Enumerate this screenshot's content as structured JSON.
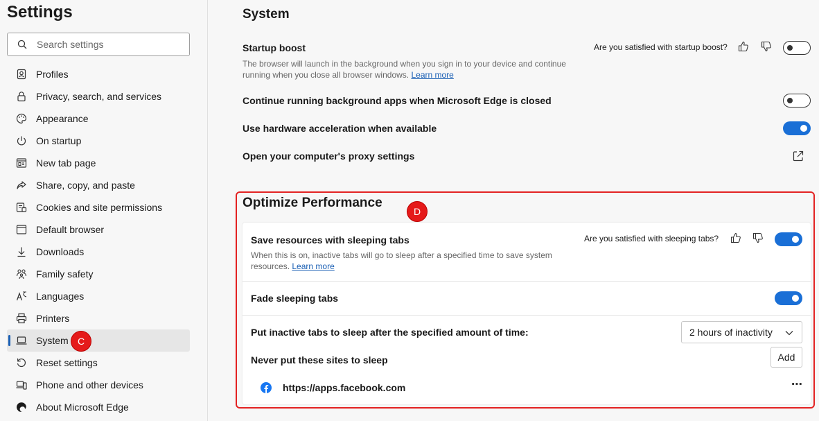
{
  "sidebar": {
    "title": "Settings",
    "search_placeholder": "Search settings",
    "items": [
      {
        "label": "Profiles",
        "icon": "profile-icon"
      },
      {
        "label": "Privacy, search, and services",
        "icon": "lock-icon"
      },
      {
        "label": "Appearance",
        "icon": "palette-icon"
      },
      {
        "label": "On startup",
        "icon": "power-icon"
      },
      {
        "label": "New tab page",
        "icon": "grid-icon"
      },
      {
        "label": "Share, copy, and paste",
        "icon": "share-icon"
      },
      {
        "label": "Cookies and site permissions",
        "icon": "cookies-icon"
      },
      {
        "label": "Default browser",
        "icon": "browser-icon"
      },
      {
        "label": "Downloads",
        "icon": "download-icon"
      },
      {
        "label": "Family safety",
        "icon": "family-icon"
      },
      {
        "label": "Languages",
        "icon": "language-icon"
      },
      {
        "label": "Printers",
        "icon": "printer-icon"
      },
      {
        "label": "System",
        "icon": "laptop-icon",
        "active": true
      },
      {
        "label": "Reset settings",
        "icon": "reset-icon"
      },
      {
        "label": "Phone and other devices",
        "icon": "phone-icon"
      },
      {
        "label": "About Microsoft Edge",
        "icon": "edge-icon"
      }
    ]
  },
  "markers": {
    "c": "C",
    "d": "D"
  },
  "system": {
    "title": "System",
    "startup_boost": {
      "title": "Startup boost",
      "desc": "The browser will launch in the background when you sign in to your device and continue running when you close all browser windows.",
      "learn_more": "Learn more",
      "feedback": "Are you satisfied with startup boost?",
      "enabled": false
    },
    "background_apps": {
      "title": "Continue running background apps when Microsoft Edge is closed",
      "enabled": false
    },
    "hardware_accel": {
      "title": "Use hardware acceleration when available",
      "enabled": true
    },
    "proxy": {
      "title": "Open your computer's proxy settings"
    }
  },
  "performance": {
    "title": "Optimize Performance",
    "sleeping_tabs": {
      "title": "Save resources with sleeping tabs",
      "desc": "When this is on, inactive tabs will go to sleep after a specified time to save system resources.",
      "learn_more": "Learn more",
      "feedback": "Are you satisfied with sleeping tabs?",
      "enabled": true
    },
    "fade": {
      "title": "Fade sleeping tabs",
      "enabled": true
    },
    "sleep_after": {
      "title": "Put inactive tabs to sleep after the specified amount of time:",
      "value": "2 hours of inactivity"
    },
    "never_sleep": {
      "title": "Never put these sites to sleep",
      "add_label": "Add",
      "sites": [
        "https://apps.facebook.com"
      ],
      "more": "⋯"
    }
  },
  "colors": {
    "accent": "#1a6fd6",
    "marker": "#e51a1a",
    "highlight": "#e32222"
  }
}
